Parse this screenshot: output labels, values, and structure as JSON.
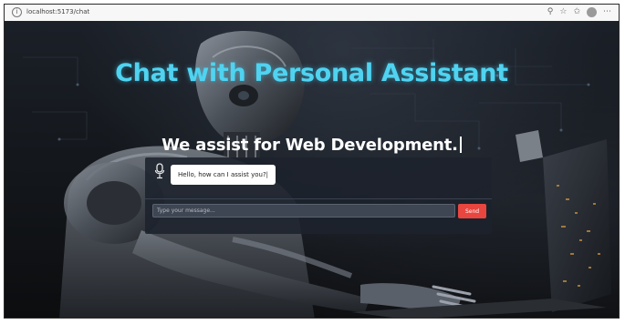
{
  "browser": {
    "url": "localhost:5173/chat",
    "info_icon": "info-icon",
    "icons": [
      "search-icon",
      "star-icon",
      "favorites-icon",
      "profile-icon",
      "more-icon"
    ]
  },
  "page": {
    "title": "Chat with Personal Assistant",
    "subtitle": "We assist for Web Development."
  },
  "chat": {
    "bot_icon": "microphone-icon",
    "messages": [
      {
        "sender": "bot",
        "text": "Hello, how can I assist you?|"
      }
    ],
    "input_placeholder": "Type your message...",
    "send_label": "Send"
  },
  "colors": {
    "title": "#4fd3f0",
    "send_button": "#e8463f",
    "panel": "#1c222c"
  }
}
